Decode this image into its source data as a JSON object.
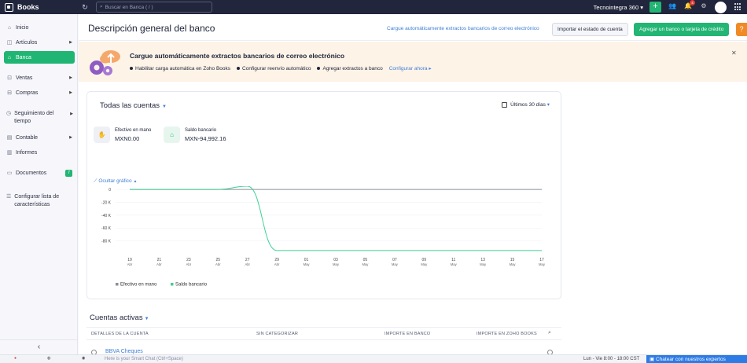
{
  "topbar": {
    "app_name": "Books",
    "search_placeholder": "Buscar en Banca ( / )",
    "org_name": "Tecnointegra 360",
    "notif_count": "4"
  },
  "sidebar": {
    "items": [
      {
        "label": "Inicio",
        "icon": "home-icon"
      },
      {
        "label": "Artículos",
        "icon": "cube-icon"
      },
      {
        "label": "Banca",
        "icon": "bank-icon"
      },
      {
        "label": "Ventas",
        "icon": "cart-icon"
      },
      {
        "label": "Compras",
        "icon": "bag-icon"
      },
      {
        "label": "Seguimiento del tiempo",
        "icon": "clock-icon"
      },
      {
        "label": "Contable",
        "icon": "ledger-icon"
      },
      {
        "label": "Informes",
        "icon": "chart-icon"
      },
      {
        "label": "Documentos",
        "icon": "folder-icon",
        "badge": "7"
      },
      {
        "label": "Configurar lista de características",
        "icon": "list-icon"
      }
    ]
  },
  "header": {
    "title": "Descripción general del banco",
    "email_link": "Cargue automáticamente extractos bancarios de correo electrónico",
    "import_button": "Importar el estado de cuenta",
    "add_button": "Agregar un banco o tarjeta de crédito",
    "help": "?"
  },
  "banner": {
    "title": "Cargue automáticamente extractos bancarios de correo electrónico",
    "steps": [
      "Habilitar carga automática en Zoho Books",
      "Configurar reenvío automático",
      "Agregar extractos a banco"
    ],
    "cta": "Configurar ahora ▸"
  },
  "accounts": {
    "title": "Todas las cuentas",
    "period": "Últimos 30 días",
    "cash_label": "Efectivo en mano",
    "cash_value": "MXN0.00",
    "bank_label": "Saldo bancario",
    "bank_value": "MXN-94,992.16",
    "toggle_chart": "Ocultar gráfico"
  },
  "chart_data": {
    "type": "line",
    "x": [
      "19 Abr",
      "21 Abr",
      "23 Abr",
      "25 Abr",
      "27 Abr",
      "29 Abr",
      "01 May",
      "03 May",
      "05 May",
      "07 May",
      "09 May",
      "11 May",
      "13 May",
      "15 May",
      "17 May"
    ],
    "series": [
      {
        "name": "Efectivo en mano",
        "color": "#8a8f99",
        "values": [
          0,
          0,
          0,
          0,
          0,
          0,
          0,
          0,
          0,
          0,
          0,
          0,
          0,
          0,
          0
        ]
      },
      {
        "name": "Saldo bancario",
        "color": "#3fcf95",
        "values": [
          0,
          0,
          0,
          0,
          5000,
          -94992,
          -94992,
          -94992,
          -94992,
          -94992,
          -94992,
          -94992,
          -94992,
          -94992,
          -94992
        ]
      }
    ],
    "y_ticks": [
      "0",
      "-20 K",
      "-40 K",
      "-60 K",
      "-80 K"
    ],
    "ylim": [
      -100000,
      5000
    ],
    "legend": "bottom-left"
  },
  "active": {
    "title": "Cuentas activas",
    "columns": [
      "DETALLES DE LA CUENTA",
      "SIN CATEGORIZAR",
      "IMPORTE EN BANCO",
      "IMPORTE EN ZOHO BOOKS"
    ],
    "row_name": "BBVA Cheques"
  },
  "bottombar": {
    "chat_placeholder": "Here is your Smart Chat (Ctrl+Space)",
    "hours": "Lun - Vie 8:00 - 18:00 CST",
    "chat_button": "Chatear con nuestros expertos"
  }
}
